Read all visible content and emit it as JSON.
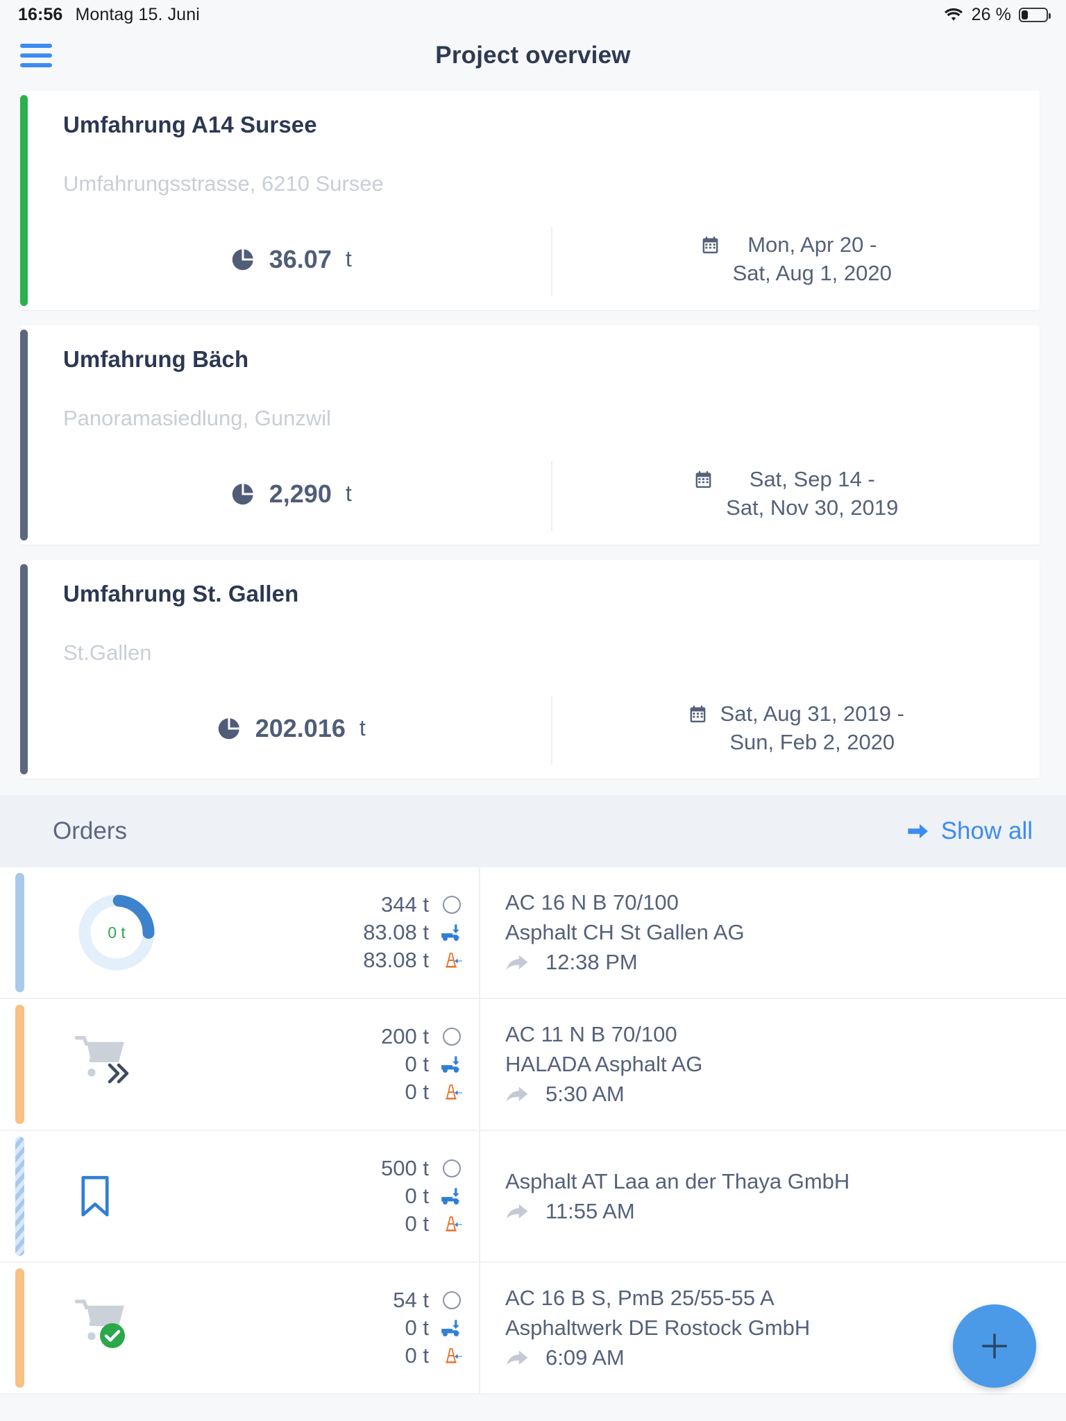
{
  "status_bar": {
    "time": "16:56",
    "date": "Montag 15. Juni",
    "battery_percent": "26 %",
    "wifi_icon": "wifi-icon",
    "battery_icon": "battery-icon"
  },
  "nav": {
    "menu_icon": "hamburger-menu-icon",
    "title": "Project overview"
  },
  "projects": [
    {
      "name": "Umfahrung A14 Sursee",
      "address": "Umfahrungsstrasse, 6210 Sursee",
      "tonnage_value": "36.07",
      "tonnage_unit": "t",
      "tonnage_icon": "pie-chart-icon",
      "date_icon": "calendar-icon",
      "date_line1": "Mon, Apr 20 -",
      "date_line2": "Sat, Aug 1, 2020",
      "accent_color": "#2ab14e"
    },
    {
      "name": "Umfahrung Bäch",
      "address": "Panoramasiedlung, Gunzwil",
      "tonnage_value": "2,290",
      "tonnage_unit": "t",
      "tonnage_icon": "pie-chart-icon",
      "date_icon": "calendar-icon",
      "date_line1": "Sat, Sep 14 -",
      "date_line2": "Sat, Nov 30, 2019",
      "accent_color": "#5a677f"
    },
    {
      "name": "Umfahrung St. Gallen",
      "address": "St.Gallen",
      "tonnage_value": "202.016",
      "tonnage_unit": "t",
      "tonnage_icon": "pie-chart-icon",
      "date_icon": "calendar-icon",
      "date_line1": "Sat, Aug 31, 2019  -",
      "date_line2": "Sun, Feb 2, 2020",
      "accent_color": "#5a677f"
    }
  ],
  "orders_section": {
    "title": "Orders",
    "show_all_label": "Show all",
    "show_all_icon": "arrow-right-icon",
    "show_all_color": "#3d8bf2"
  },
  "orders": [
    {
      "accent_color": "#a9c9ec",
      "accent_striped": false,
      "marker_icon": "progress-donut-chart",
      "donut": {
        "label": "0 t",
        "percent": 24,
        "track_color": "#e3effb",
        "arc_color": "#3d82cc",
        "label_color": "#2aa84a"
      },
      "amount_ordered": "344 t",
      "amount_delivered": "83.08 t",
      "amount_installed": "83.08 t",
      "ordered_icon": "circle-outline-icon",
      "delivered_icon": "truck-icon",
      "installed_icon": "traffic-cone-icon",
      "product": "AC 16 N B 70/100",
      "supplier": "Asphalt CH St Gallen AG",
      "time_icon": "share-arrow-icon",
      "time": "12:38 PM"
    },
    {
      "accent_color": "#f8c082",
      "accent_striped": false,
      "marker_icon": "cart-forward-icon",
      "donut": null,
      "amount_ordered": "200 t",
      "amount_delivered": "0 t",
      "amount_installed": "0 t",
      "ordered_icon": "circle-outline-icon",
      "delivered_icon": "truck-icon",
      "installed_icon": "traffic-cone-icon",
      "product": "AC 11 N B 70/100",
      "supplier": "HALADA Asphalt AG",
      "time_icon": "share-arrow-icon",
      "time": "5:30 AM"
    },
    {
      "accent_color": "#a9c9ec",
      "accent_striped": true,
      "marker_icon": "bookmark-icon",
      "donut": null,
      "amount_ordered": "500 t",
      "amount_delivered": "0 t",
      "amount_installed": "0 t",
      "ordered_icon": "circle-outline-icon",
      "delivered_icon": "truck-icon",
      "installed_icon": "traffic-cone-icon",
      "product": "",
      "supplier": "Asphalt AT Laa an der Thaya GmbH",
      "time_icon": "share-arrow-icon",
      "time": "11:55 AM"
    },
    {
      "accent_color": "#f8c082",
      "accent_striped": false,
      "marker_icon": "cart-check-icon",
      "donut": null,
      "amount_ordered": "54 t",
      "amount_delivered": "0 t",
      "amount_installed": "0 t",
      "ordered_icon": "circle-outline-icon",
      "delivered_icon": "truck-icon",
      "installed_icon": "traffic-cone-icon",
      "product": "AC 16 B S, PmB 25/55-55 A",
      "supplier": "Asphaltwerk DE Rostock GmbH",
      "time_icon": "share-arrow-icon",
      "time": "6:09 AM"
    }
  ],
  "fab": {
    "icon": "plus-icon",
    "color": "#4a9ae8"
  }
}
